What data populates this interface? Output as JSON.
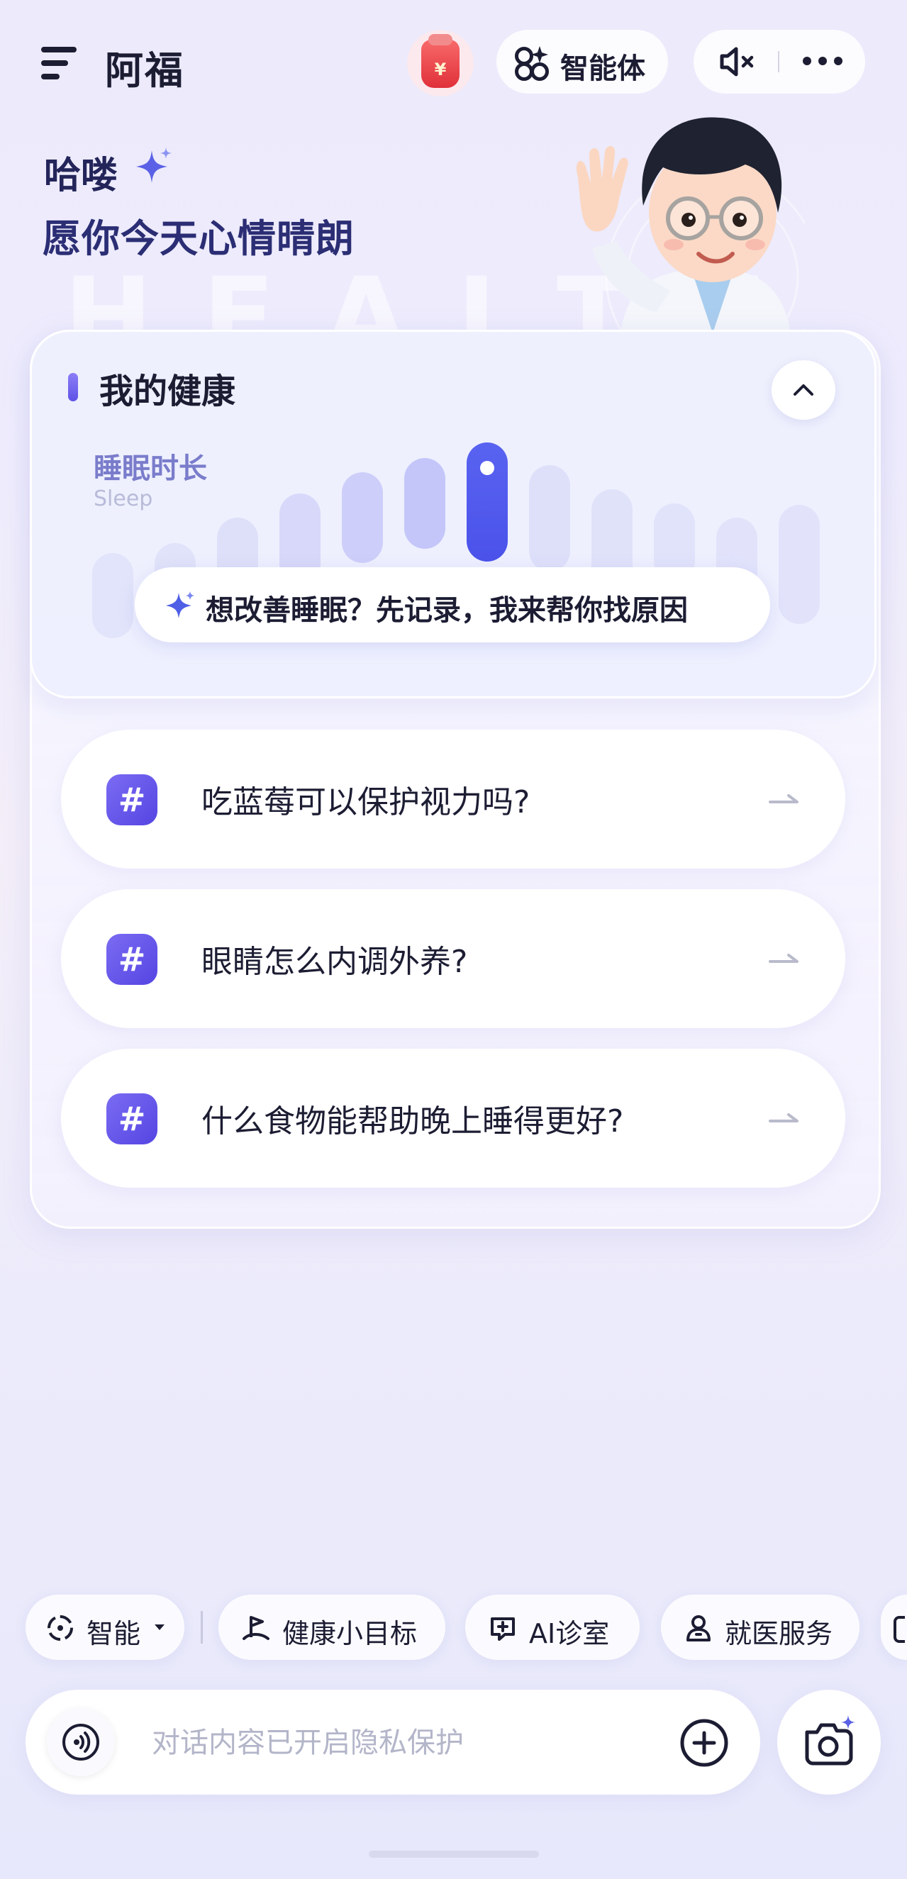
{
  "header": {
    "app_title": "阿福",
    "agent_label": "智能体",
    "icons": [
      "menu-icon",
      "red-packet-icon",
      "agent-grid-icon",
      "speaker-mute-icon",
      "more-icon"
    ]
  },
  "greeting": {
    "hello": "哈喽",
    "wish": "愿你今天心情晴朗"
  },
  "health_card": {
    "title": "我的健康",
    "metric_label": "睡眠时长",
    "metric_label_en": "Sleep",
    "tip": "想改善睡眠？先记录，我来帮你找原因",
    "questions": [
      "吃蓝莓可以保护视力吗?",
      "眼睛怎么内调外养?",
      "什么食物能帮助晚上睡得更好?"
    ]
  },
  "chips": {
    "mode": "智能",
    "items": [
      "健康小目标",
      "AI诊室",
      "就医服务"
    ]
  },
  "input": {
    "placeholder": "对话内容已开启隐私保护"
  },
  "colors": {
    "accent": "#5b4fe6",
    "text": "#1c1d33",
    "title_blue": "#2b2e74"
  }
}
